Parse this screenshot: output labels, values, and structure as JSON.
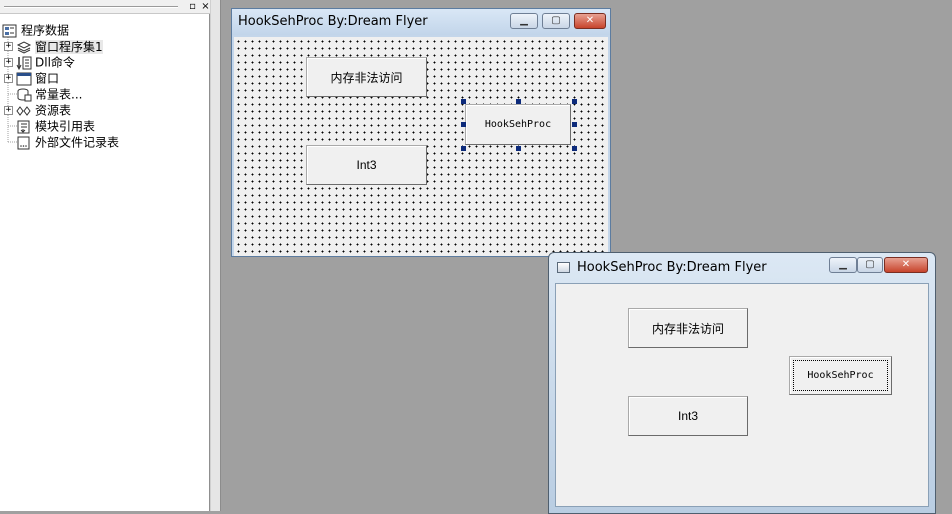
{
  "left_panel": {
    "tree": [
      {
        "label": "程序数据",
        "icon": "program-data-icon",
        "indent": 0,
        "expander": "none"
      },
      {
        "label": "窗口程序集1",
        "icon": "assembly-icon",
        "indent": 1,
        "expander": "+"
      },
      {
        "label": "Dll命令",
        "icon": "dll-command-icon",
        "indent": 1,
        "expander": "+"
      },
      {
        "label": "窗口",
        "icon": "window-icon",
        "indent": 1,
        "expander": "+"
      },
      {
        "label": "常量表...",
        "icon": "constant-table-icon",
        "indent": 1,
        "expander": "none"
      },
      {
        "label": "资源表",
        "icon": "resource-table-icon",
        "indent": 1,
        "expander": "+"
      },
      {
        "label": "模块引用表",
        "icon": "module-reference-icon",
        "indent": 1,
        "expander": "none"
      },
      {
        "label": "外部文件记录表",
        "icon": "external-file-icon",
        "indent": 1,
        "expander": "none"
      }
    ],
    "pin_glyph": "▫",
    "close_glyph": "×"
  },
  "designer": {
    "title": "HookSehProc By:Dream Flyer",
    "buttons": {
      "access_violation": "内存非法访问",
      "hook": "HookSehProc",
      "int3": "Int3"
    }
  },
  "runtime": {
    "title": "HookSehProc By:Dream Flyer",
    "buttons": {
      "access_violation": "内存非法访问",
      "hook": "HookSehProc",
      "int3": "Int3"
    }
  },
  "caption_glyphs": {
    "minimize": "▁",
    "maximize": "▢",
    "close": "✕"
  },
  "colors": {
    "workspace": "#a0a0a0",
    "selection_handle": "#0c2a7a",
    "close_button": "#c7442c"
  }
}
